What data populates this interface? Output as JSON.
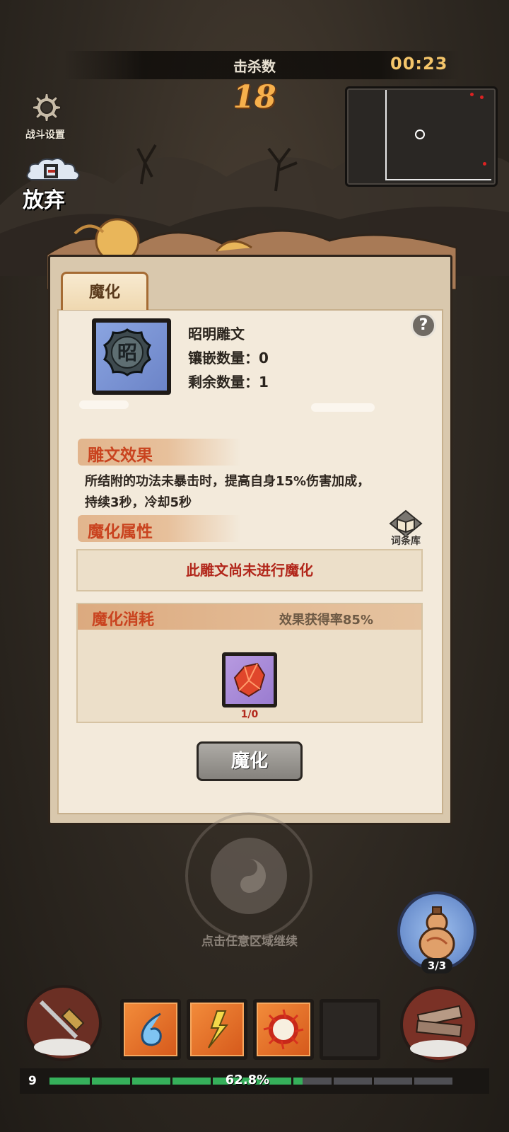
{
  "hud": {
    "kills_label": "击杀数",
    "kills": "18",
    "timer": "00:23",
    "settings_label": "战斗设置",
    "quit_label": "放弃"
  },
  "panel": {
    "tab_label": "魔化",
    "item": {
      "name": "昭明雕文",
      "inlaid": "镶嵌数量：0",
      "remaining": "剩余数量：1",
      "glyph_char": "昭"
    },
    "help_label": "?",
    "effect_header": "雕文效果",
    "effect_line1": "所结附的功法未暴击时，提高自身15%伤害加成，",
    "effect_line2": "持续3秒，冷却5秒",
    "attr_header": "魔化属性",
    "library_label": "词条库",
    "not_enchanted": "此雕文尚未进行魔化",
    "cost_header": "魔化消耗",
    "cost_rate": "效果获得率85%",
    "material_count": "1/0",
    "enchant_button": "魔化"
  },
  "continue_hint": "点击任意区域继续",
  "gourd_count": "3/3",
  "skills": [
    {
      "icon": "water-drop-icon"
    },
    {
      "icon": "gold-lightning-icon"
    },
    {
      "icon": "fire-burst-icon"
    },
    {
      "icon": "empty-slot"
    }
  ],
  "xp": {
    "level": "9",
    "percent_text": "62.8%",
    "fraction": 0.628
  },
  "colors": {
    "accent_red": "#c9431f",
    "warning_red": "#b2271b",
    "xp_green": "#36b05b",
    "kill_orange": "#f6b04c"
  }
}
